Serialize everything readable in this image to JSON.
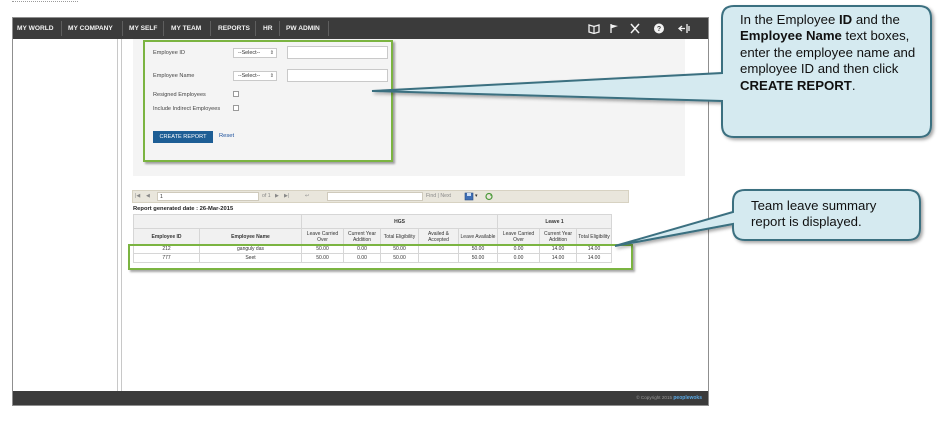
{
  "nav": {
    "items": [
      "MY WORLD",
      "MY COMPANY",
      "MY SELF",
      "MY TEAM",
      "REPORTS",
      "HR",
      "PW ADMIN"
    ],
    "icons": [
      "book-icon",
      "flag-icon",
      "tools-icon",
      "help-icon",
      "logout-icon"
    ]
  },
  "filters": {
    "employee_id_label": "Employee ID",
    "employee_name_label": "Employee Name",
    "select_placeholder": "--Select--",
    "resigned_label": "Resigned Employees",
    "indirect_label": "Include Indirect Employees",
    "create_button": "CREATE REPORT",
    "reset_link": "Reset"
  },
  "toolbar": {
    "page_value": "1",
    "page_of": "of 1",
    "find_next": "Find | Next"
  },
  "report": {
    "generated": "Report generated date : 26-Mar-2015",
    "group_hgs": "HGS",
    "group_leave1": "Leave 1",
    "columns": [
      "Employee ID",
      "Employee Name",
      "Leave Carried Over",
      "Current Year Addition",
      "Total Eligibility",
      "Availed & Accepted",
      "Leave Available",
      "Leave Carried Over",
      "Current Year Addition",
      "Total Eligibility"
    ],
    "rows": [
      [
        "212",
        "ganguly  das",
        "50.00",
        "0.00",
        "50.00",
        "",
        "50.00",
        "0.00",
        "14.00",
        "14.00"
      ],
      [
        "777",
        "Seet",
        "50.00",
        "0.00",
        "50.00",
        "",
        "50.00",
        "0.00",
        "14.00",
        "14.00"
      ]
    ]
  },
  "footer": {
    "copyright": "© Copyright 2015",
    "brand": "peoplewoks"
  },
  "callouts": {
    "one": {
      "p1": "In the Employee ",
      "b1": "ID",
      "p2": " and the ",
      "b2": "Employee Name",
      "p3": " text boxes, enter the employee name and employee ID and then click ",
      "b3": "CREATE REPORT",
      "p4": "."
    },
    "two": {
      "text": "Team leave summary report is displayed."
    }
  },
  "colors": {
    "nav_bg": "#3b3b3b",
    "button_blue": "#1d5e95",
    "highlight_green": "#7bb441",
    "callout_fill": "#d5eaf0",
    "callout_border": "#3a6f80"
  }
}
